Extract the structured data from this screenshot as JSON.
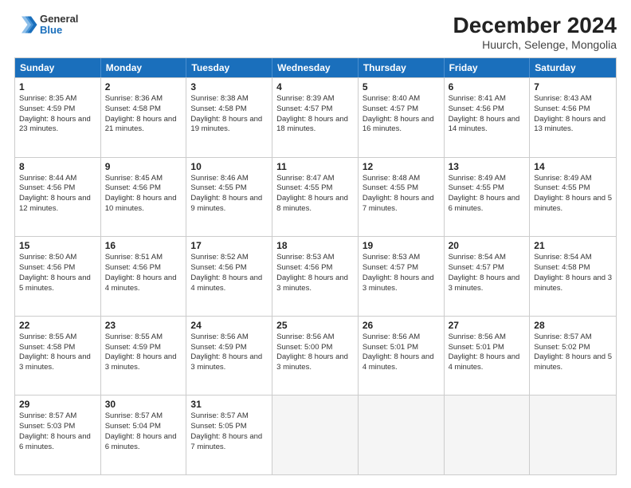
{
  "logo": {
    "general": "General",
    "blue": "Blue"
  },
  "title": "December 2024",
  "subtitle": "Huurch, Selenge, Mongolia",
  "header_days": [
    "Sunday",
    "Monday",
    "Tuesday",
    "Wednesday",
    "Thursday",
    "Friday",
    "Saturday"
  ],
  "rows": [
    [
      {
        "date": "1",
        "sunrise": "Sunrise: 8:35 AM",
        "sunset": "Sunset: 4:59 PM",
        "daylight": "Daylight: 8 hours and 23 minutes."
      },
      {
        "date": "2",
        "sunrise": "Sunrise: 8:36 AM",
        "sunset": "Sunset: 4:58 PM",
        "daylight": "Daylight: 8 hours and 21 minutes."
      },
      {
        "date": "3",
        "sunrise": "Sunrise: 8:38 AM",
        "sunset": "Sunset: 4:58 PM",
        "daylight": "Daylight: 8 hours and 19 minutes."
      },
      {
        "date": "4",
        "sunrise": "Sunrise: 8:39 AM",
        "sunset": "Sunset: 4:57 PM",
        "daylight": "Daylight: 8 hours and 18 minutes."
      },
      {
        "date": "5",
        "sunrise": "Sunrise: 8:40 AM",
        "sunset": "Sunset: 4:57 PM",
        "daylight": "Daylight: 8 hours and 16 minutes."
      },
      {
        "date": "6",
        "sunrise": "Sunrise: 8:41 AM",
        "sunset": "Sunset: 4:56 PM",
        "daylight": "Daylight: 8 hours and 14 minutes."
      },
      {
        "date": "7",
        "sunrise": "Sunrise: 8:43 AM",
        "sunset": "Sunset: 4:56 PM",
        "daylight": "Daylight: 8 hours and 13 minutes."
      }
    ],
    [
      {
        "date": "8",
        "sunrise": "Sunrise: 8:44 AM",
        "sunset": "Sunset: 4:56 PM",
        "daylight": "Daylight: 8 hours and 12 minutes."
      },
      {
        "date": "9",
        "sunrise": "Sunrise: 8:45 AM",
        "sunset": "Sunset: 4:56 PM",
        "daylight": "Daylight: 8 hours and 10 minutes."
      },
      {
        "date": "10",
        "sunrise": "Sunrise: 8:46 AM",
        "sunset": "Sunset: 4:55 PM",
        "daylight": "Daylight: 8 hours and 9 minutes."
      },
      {
        "date": "11",
        "sunrise": "Sunrise: 8:47 AM",
        "sunset": "Sunset: 4:55 PM",
        "daylight": "Daylight: 8 hours and 8 minutes."
      },
      {
        "date": "12",
        "sunrise": "Sunrise: 8:48 AM",
        "sunset": "Sunset: 4:55 PM",
        "daylight": "Daylight: 8 hours and 7 minutes."
      },
      {
        "date": "13",
        "sunrise": "Sunrise: 8:49 AM",
        "sunset": "Sunset: 4:55 PM",
        "daylight": "Daylight: 8 hours and 6 minutes."
      },
      {
        "date": "14",
        "sunrise": "Sunrise: 8:49 AM",
        "sunset": "Sunset: 4:55 PM",
        "daylight": "Daylight: 8 hours and 5 minutes."
      }
    ],
    [
      {
        "date": "15",
        "sunrise": "Sunrise: 8:50 AM",
        "sunset": "Sunset: 4:56 PM",
        "daylight": "Daylight: 8 hours and 5 minutes."
      },
      {
        "date": "16",
        "sunrise": "Sunrise: 8:51 AM",
        "sunset": "Sunset: 4:56 PM",
        "daylight": "Daylight: 8 hours and 4 minutes."
      },
      {
        "date": "17",
        "sunrise": "Sunrise: 8:52 AM",
        "sunset": "Sunset: 4:56 PM",
        "daylight": "Daylight: 8 hours and 4 minutes."
      },
      {
        "date": "18",
        "sunrise": "Sunrise: 8:53 AM",
        "sunset": "Sunset: 4:56 PM",
        "daylight": "Daylight: 8 hours and 3 minutes."
      },
      {
        "date": "19",
        "sunrise": "Sunrise: 8:53 AM",
        "sunset": "Sunset: 4:57 PM",
        "daylight": "Daylight: 8 hours and 3 minutes."
      },
      {
        "date": "20",
        "sunrise": "Sunrise: 8:54 AM",
        "sunset": "Sunset: 4:57 PM",
        "daylight": "Daylight: 8 hours and 3 minutes."
      },
      {
        "date": "21",
        "sunrise": "Sunrise: 8:54 AM",
        "sunset": "Sunset: 4:58 PM",
        "daylight": "Daylight: 8 hours and 3 minutes."
      }
    ],
    [
      {
        "date": "22",
        "sunrise": "Sunrise: 8:55 AM",
        "sunset": "Sunset: 4:58 PM",
        "daylight": "Daylight: 8 hours and 3 minutes."
      },
      {
        "date": "23",
        "sunrise": "Sunrise: 8:55 AM",
        "sunset": "Sunset: 4:59 PM",
        "daylight": "Daylight: 8 hours and 3 minutes."
      },
      {
        "date": "24",
        "sunrise": "Sunrise: 8:56 AM",
        "sunset": "Sunset: 4:59 PM",
        "daylight": "Daylight: 8 hours and 3 minutes."
      },
      {
        "date": "25",
        "sunrise": "Sunrise: 8:56 AM",
        "sunset": "Sunset: 5:00 PM",
        "daylight": "Daylight: 8 hours and 3 minutes."
      },
      {
        "date": "26",
        "sunrise": "Sunrise: 8:56 AM",
        "sunset": "Sunset: 5:01 PM",
        "daylight": "Daylight: 8 hours and 4 minutes."
      },
      {
        "date": "27",
        "sunrise": "Sunrise: 8:56 AM",
        "sunset": "Sunset: 5:01 PM",
        "daylight": "Daylight: 8 hours and 4 minutes."
      },
      {
        "date": "28",
        "sunrise": "Sunrise: 8:57 AM",
        "sunset": "Sunset: 5:02 PM",
        "daylight": "Daylight: 8 hours and 5 minutes."
      }
    ],
    [
      {
        "date": "29",
        "sunrise": "Sunrise: 8:57 AM",
        "sunset": "Sunset: 5:03 PM",
        "daylight": "Daylight: 8 hours and 6 minutes."
      },
      {
        "date": "30",
        "sunrise": "Sunrise: 8:57 AM",
        "sunset": "Sunset: 5:04 PM",
        "daylight": "Daylight: 8 hours and 6 minutes."
      },
      {
        "date": "31",
        "sunrise": "Sunrise: 8:57 AM",
        "sunset": "Sunset: 5:05 PM",
        "daylight": "Daylight: 8 hours and 7 minutes."
      },
      {
        "date": "",
        "sunrise": "",
        "sunset": "",
        "daylight": ""
      },
      {
        "date": "",
        "sunrise": "",
        "sunset": "",
        "daylight": ""
      },
      {
        "date": "",
        "sunrise": "",
        "sunset": "",
        "daylight": ""
      },
      {
        "date": "",
        "sunrise": "",
        "sunset": "",
        "daylight": ""
      }
    ]
  ]
}
